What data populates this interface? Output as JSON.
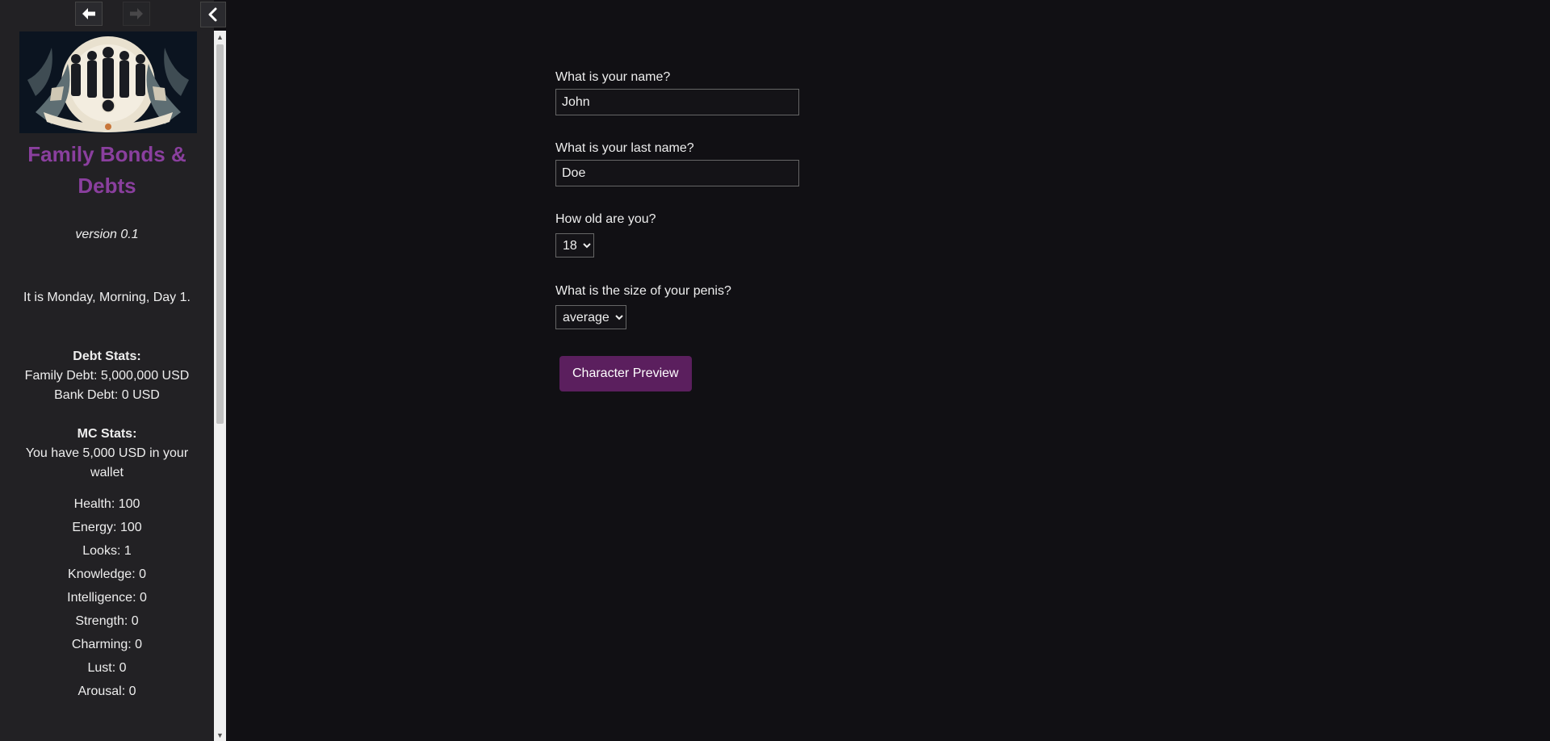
{
  "sidebar": {
    "history": {
      "back_icon": "arrow-left-icon",
      "forward_icon": "arrow-right-icon",
      "toggle_icon": "chevron-left-icon"
    },
    "banner_icon": "family-banner-image",
    "story_title": "Family Bonds & Debts",
    "version": "version 0.1",
    "time": "It is Monday, Morning, Day 1.",
    "debt_stats": {
      "heading": "Debt Stats:",
      "family_debt": "Family Debt: 5,000,000 USD",
      "bank_debt": "Bank Debt: 0 USD"
    },
    "mc_stats": {
      "heading": "MC Stats:",
      "wallet": "You have 5,000 USD in your wallet"
    },
    "stats": [
      "Health: 100",
      "Energy: 100",
      "Looks: 1",
      "Knowledge: 0",
      "Intelligence: 0",
      "Strength: 0",
      "Charming: 0",
      "Lust: 0",
      "Arousal: 0"
    ]
  },
  "form": {
    "name_label": "What is your name?",
    "name_value": "John",
    "last_name_label": "What is your last name?",
    "last_name_value": "Doe",
    "age_label": "How old are you?",
    "age_value": "18",
    "size_label": "What is the size of your penis?",
    "size_value": "average",
    "preview_button": "Character Preview"
  },
  "colors": {
    "background": "#111014",
    "sidebar": "#222124",
    "title_purple": "#8a3f9e",
    "button_purple": "#5b1f5e"
  }
}
